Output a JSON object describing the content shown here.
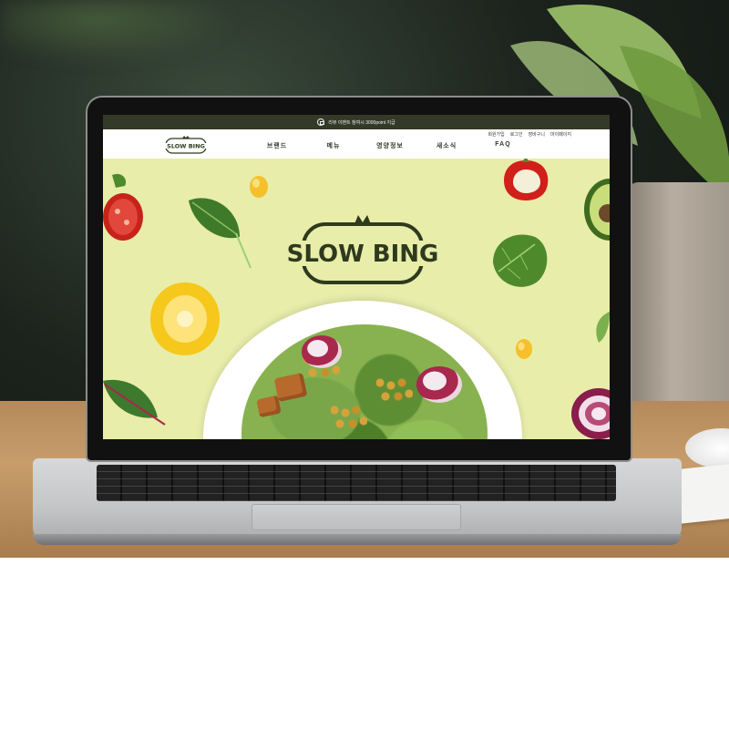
{
  "site": {
    "promo_banner": "리뷰 이벤트 참여시 3000point 지급",
    "utility_links": [
      "회원가입",
      "로그인",
      "장바구니",
      "마이페이지"
    ],
    "logo_text": "SLOW BING",
    "nav_items": [
      "브랜드",
      "메뉴",
      "영양정보",
      "새소식",
      "FAQ"
    ]
  },
  "colors": {
    "topbar": "#333a28",
    "logo": "#2f3a1c",
    "hero_background": "#e8edaa"
  },
  "icons": [
    "gift-icon",
    "tomato-logo-icon"
  ]
}
